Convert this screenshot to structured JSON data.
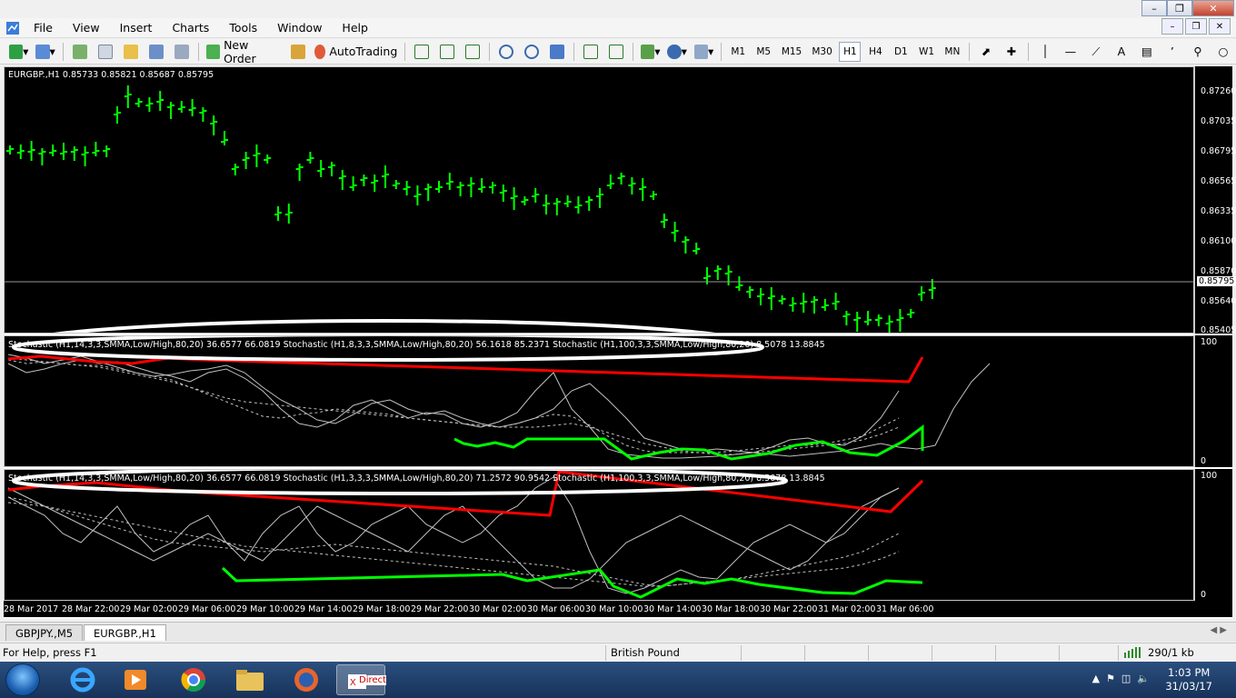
{
  "menu": [
    "File",
    "View",
    "Insert",
    "Charts",
    "Tools",
    "Window",
    "Help"
  ],
  "toolbar": {
    "new_order": "New Order",
    "autotrading": "AutoTrading",
    "timeframes": [
      "M1",
      "M5",
      "M15",
      "M30",
      "H1",
      "H4",
      "D1",
      "W1",
      "MN"
    ],
    "active_timeframe": "H1"
  },
  "chart": {
    "title": "EURGBP.,H1  0.85733 0.85821 0.85687 0.85795",
    "price_labels": [
      "0.87260",
      "0.87035",
      "0.86795",
      "0.86565",
      "0.86335",
      "0.86100",
      "0.85870",
      "0.85640",
      "0.85405"
    ],
    "current_price": "0.85795",
    "ind1_title": "Stochastic (H1,14,3,3,SMMA,Low/High,80,20) 36.6577 66.0819  Stochastic (H1,8,3,3,SMMA,Low/High,80,20) 56.1618 85.2371  Stochastic (H1,100,3,3,SMMA,Low/High,80,20) 8.5078 13.8845",
    "ind2_title": "Stochastic (H1,14,3,3,SMMA,Low/High,80,20) 36.6577 66.0819  Stochastic (H1,3,3,3,SMMA,Low/High,80,20) 71.2572 90.9542  Stochastic (H1,100,3,3,SMMA,Low/High,80,20) 8.5078 13.8845",
    "ind_max": "100",
    "ind_min": "0",
    "time_labels": [
      "28 Mar 2017",
      "28 Mar 22:00",
      "29 Mar 02:00",
      "29 Mar 06:00",
      "29 Mar 10:00",
      "29 Mar 14:00",
      "29 Mar 18:00",
      "29 Mar 22:00",
      "30 Mar 02:00",
      "30 Mar 06:00",
      "30 Mar 10:00",
      "30 Mar 14:00",
      "30 Mar 18:00",
      "30 Mar 22:00",
      "31 Mar 02:00",
      "31 Mar 06:00"
    ]
  },
  "tabs": [
    "GBPJPY.,M5",
    "EURGBP.,H1"
  ],
  "active_tab": "EURGBP.,H1",
  "status": {
    "help": "For Help, press F1",
    "profile": "British Pound",
    "traffic": "290/1 kb"
  },
  "taskbar": {
    "time": "1:03 PM",
    "date": "31/03/17",
    "app_label": "Direct"
  },
  "colors": {
    "bar": "#00ff00",
    "stoch_red": "#ff0000",
    "stoch_green": "#00ff00",
    "stoch_gray": "#c0c0c0",
    "bg": "#000000"
  }
}
